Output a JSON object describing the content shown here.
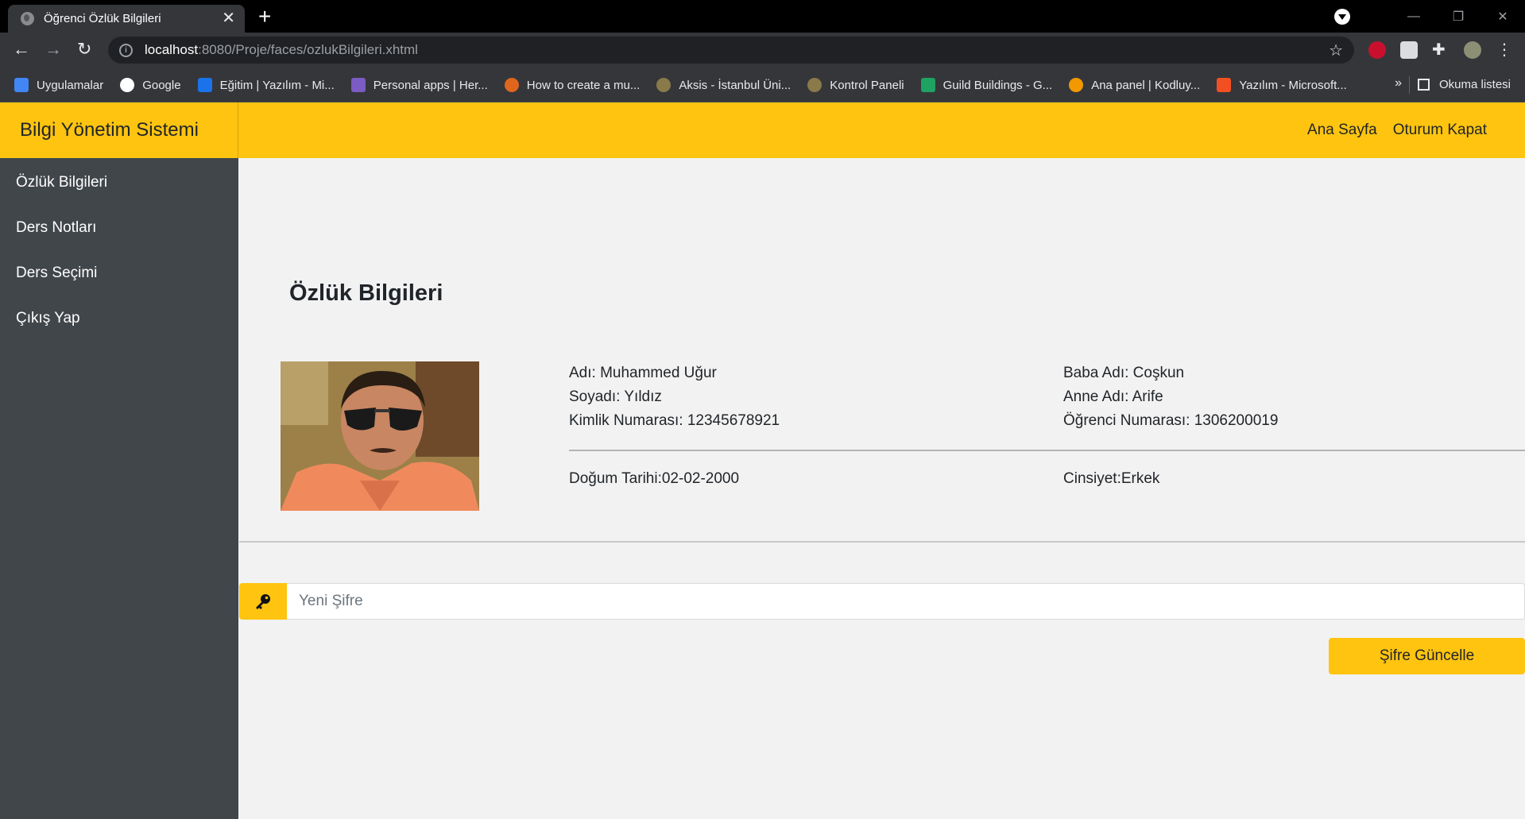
{
  "browser": {
    "tab_title": "Öğrenci Özlük Bilgileri",
    "url_host": "localhost",
    "url_path": ":8080/Proje/faces/ozlukBilgileri.xhtml",
    "bookmarks": [
      {
        "label": "Uygulamalar",
        "icon": "apps-grid-icon",
        "color": "#4285f4"
      },
      {
        "label": "Google",
        "icon": "google-icon",
        "color": "#ffffff"
      },
      {
        "label": "Eğitim | Yazılım - Mi...",
        "icon": "azure-icon",
        "color": "#1a73e8"
      },
      {
        "label": "Personal apps | Her...",
        "icon": "heroku-icon",
        "color": "#7a5cc4"
      },
      {
        "label": "How to create a mu...",
        "icon": "g-icon",
        "color": "#e0661d"
      },
      {
        "label": "Aksis - İstanbul Üni...",
        "icon": "seal-icon",
        "color": "#8a7a4a"
      },
      {
        "label": "Kontrol Paneli",
        "icon": "seal-icon",
        "color": "#8a7a4a"
      },
      {
        "label": "Guild Buildings - G...",
        "icon": "sheets-icon",
        "color": "#1ea362"
      },
      {
        "label": "Ana panel | Kodluy...",
        "icon": "rocket-icon",
        "color": "#f29900"
      },
      {
        "label": "Yazılım - Microsoft...",
        "icon": "microsoft-icon",
        "color": "#f25022"
      }
    ],
    "more_label": "»",
    "reading_list": "Okuma listesi"
  },
  "app": {
    "brand": "Bilgi Yönetim Sistemi",
    "top_links": [
      "Ana Sayfa",
      "Oturum Kapat"
    ],
    "sidebar": [
      "Özlük Bilgileri",
      "Ders Notları",
      "Ders Seçimi",
      "Çıkış Yap"
    ]
  },
  "profile": {
    "title": "Özlük Bilgileri",
    "left": [
      "Adı: Muhammed Uğur",
      "Soyadı: Yıldız",
      "Kimlik Numarası: 12345678921"
    ],
    "right": [
      "Baba Adı: Coşkun",
      "Anne Adı: Arife",
      "Öğrenci Numarası: 1306200019"
    ],
    "birth": "Doğum Tarihi:02-02-2000",
    "gender": "Cinsiyet:Erkek"
  },
  "password": {
    "placeholder": "Yeni Şifre",
    "button": "Şifre Güncelle"
  },
  "colors": {
    "accent": "#ffc410",
    "sidebar": "#41464b"
  }
}
